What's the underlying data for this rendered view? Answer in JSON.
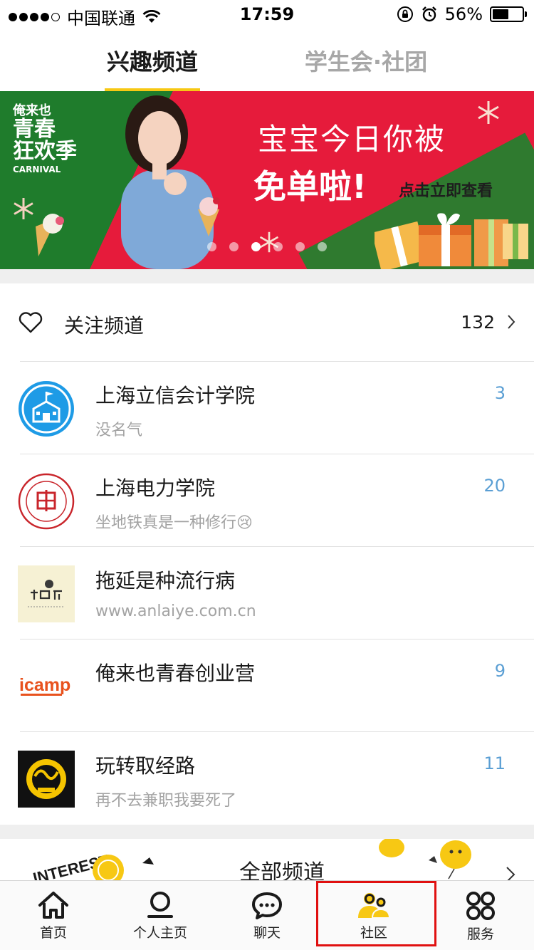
{
  "status_bar": {
    "carrier": "中国联通",
    "time": "17:59",
    "battery_percent": "56%",
    "battery_level": 0.56,
    "signal_bars_filled": 4,
    "signal_bars_total": 5
  },
  "top_tabs": [
    {
      "label": "兴趣频道",
      "active": true
    },
    {
      "label": "学生会·社团",
      "active": false
    }
  ],
  "banner": {
    "brand_small": "俺来也",
    "brand_big_1": "青春",
    "brand_big_2": "狂欢季",
    "brand_tag": "CARNIVAL",
    "headline_1": "宝宝今日你被",
    "headline_2": "免单啦!",
    "cta": "点击立即查看",
    "page_count": 6,
    "active_page_index": 2
  },
  "follow": {
    "label": "关注频道",
    "count": "132"
  },
  "channels": [
    {
      "title": "上海立信会计学院",
      "subtitle": "没名气",
      "count": "3",
      "avatar": "school-building-icon"
    },
    {
      "title": "上海电力学院",
      "subtitle": "坐地铁真是一种修行😢",
      "count": "20",
      "avatar": "university-seal-icon"
    },
    {
      "title": "拖延是种流行病",
      "subtitle": "www.anlaiye.com.cn",
      "count": "",
      "avatar": "procrastination-logo"
    },
    {
      "title": "俺来也青春创业营",
      "subtitle": "",
      "count": "9",
      "avatar": "icamp-logo"
    },
    {
      "title": "玩转取经路",
      "subtitle": "再不去兼职我要死了",
      "count": "11",
      "avatar": "journey-logo"
    }
  ],
  "all_channels": {
    "title": "全部频道",
    "art_text": "INTEREST"
  },
  "tab_bar": [
    {
      "label": "首页",
      "icon": "home-icon",
      "active": false
    },
    {
      "label": "个人主页",
      "icon": "profile-icon",
      "active": false
    },
    {
      "label": "聊天",
      "icon": "chat-icon",
      "active": false
    },
    {
      "label": "社区",
      "icon": "community-icon",
      "active": true
    },
    {
      "label": "服务",
      "icon": "services-icon",
      "active": false
    }
  ],
  "colors": {
    "accent": "#f7c814",
    "count_blue": "#5b9fd4",
    "banner_red": "#e61b3b",
    "banner_green": "#1f7c2c",
    "highlight_red": "#e01010"
  }
}
